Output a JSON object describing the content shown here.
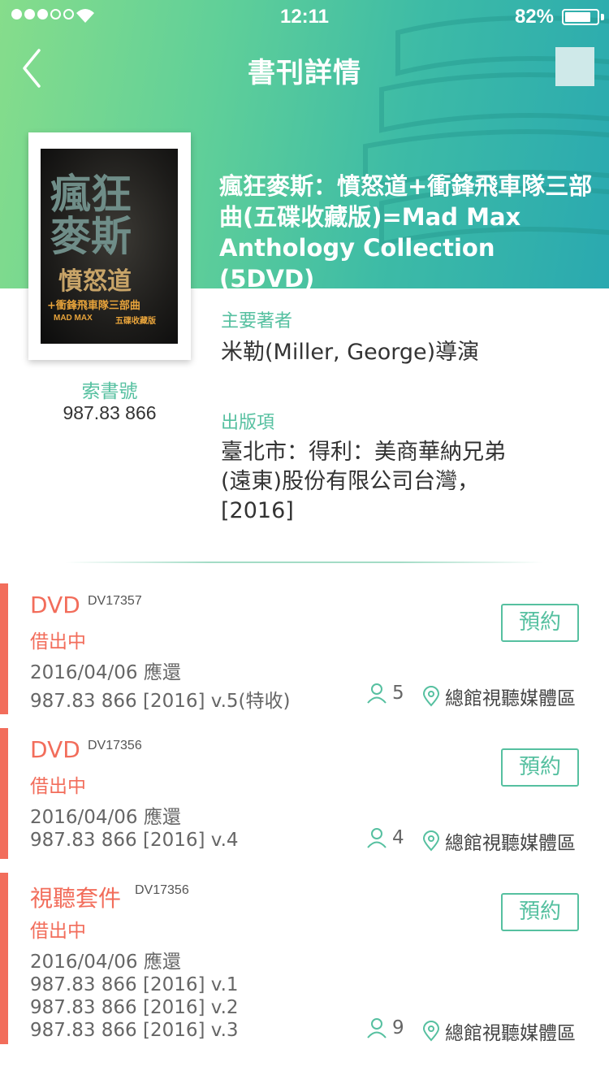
{
  "status_bar": {
    "time": "12:11",
    "battery": "82%",
    "battery_level": 0.82
  },
  "nav": {
    "title": "書刊詳情"
  },
  "book": {
    "cover_lines": [
      "瘋狂",
      "麥斯",
      "憤怒道",
      "+衝鋒飛車隊三部曲",
      "MAD MAX",
      "五碟收藏版"
    ],
    "title": "瘋狂麥斯：憤怒道+衝鋒飛車隊三部曲(五碟收藏版)=Mad Max Anthology Collection (5DVD)",
    "call_number_label": "索書號",
    "call_number": "987.83 866",
    "author_label": "主要著者",
    "author": "米勒(Miller, George)導演",
    "publisher_label": "出版項",
    "publisher": "臺北市：得利：美商華納兄弟(遠東)股份有限公司台灣，[2016]"
  },
  "holdings": [
    {
      "type": "DVD",
      "barcode": "DV17357",
      "status": "借出中",
      "due": "2016/04/06 應還",
      "volume": "987.83 866 [2016] v.5(特收)",
      "holds": "5",
      "location": "總館視聽媒體區",
      "reserve_label": "預約"
    },
    {
      "type": "DVD",
      "barcode": "DV17356",
      "status": "借出中",
      "due": "2016/04/06 應還",
      "volume": "987.83 866 [2016] v.4",
      "holds": "4",
      "location": "總館視聽媒體區",
      "reserve_label": "預約"
    },
    {
      "type": "視聽套件",
      "barcode": "DV17356",
      "status": "借出中",
      "due": "2016/04/06 應還",
      "volumes": [
        "987.83 866 [2016] v.1",
        "987.83 866 [2016] v.2",
        "987.83 866 [2016] v.3"
      ],
      "holds": "9",
      "location": "總館視聽媒體區",
      "reserve_label": "預約"
    }
  ],
  "colors": {
    "accent": "#56c0a0",
    "alert": "#f26d5b",
    "hero_start": "#86dd8b",
    "hero_end": "#2aa9b0"
  },
  "icons": [
    "back-chevron-icon",
    "person-icon",
    "location-pin-icon",
    "wifi-icon",
    "battery-icon"
  ]
}
